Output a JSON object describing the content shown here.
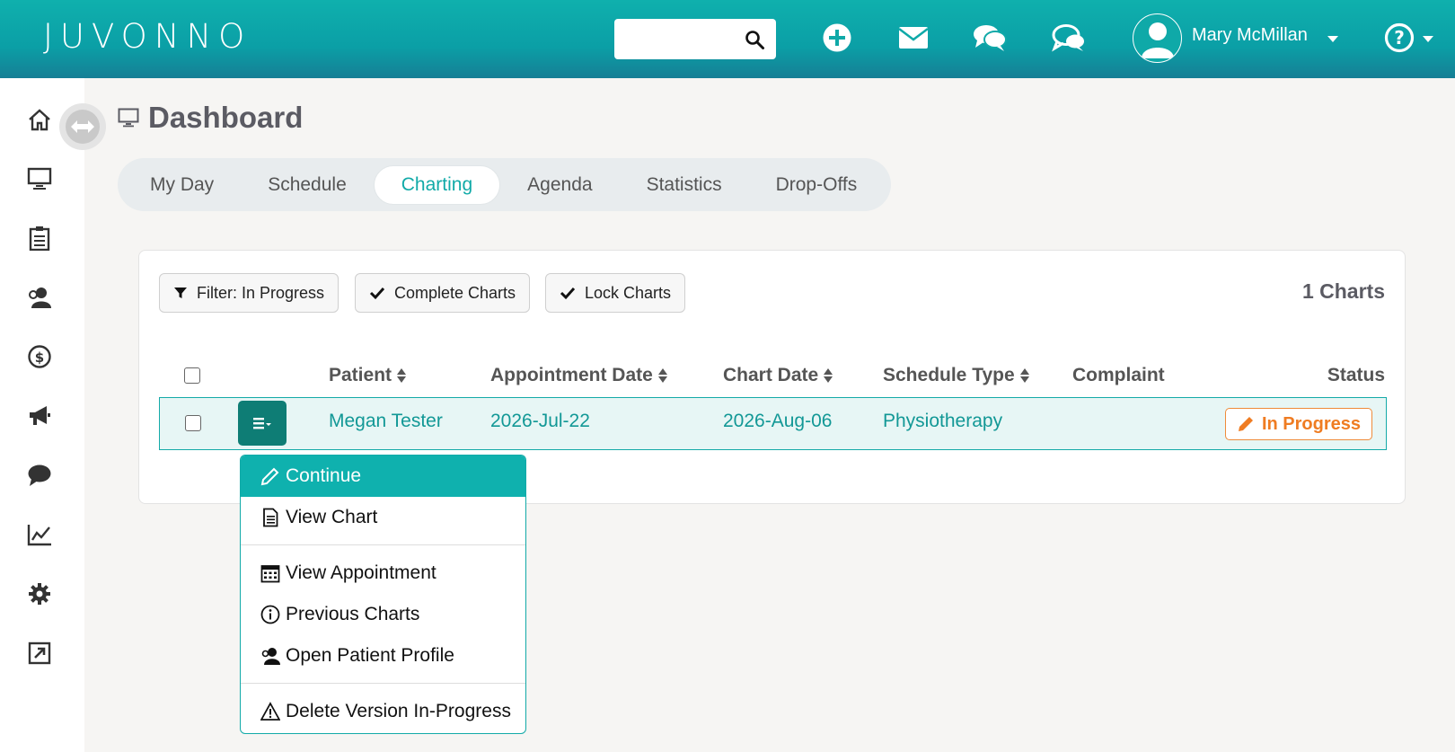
{
  "app": {
    "logo": "JUVONNO"
  },
  "header": {
    "search_placeholder": "",
    "user_name": "Mary McMillan"
  },
  "page": {
    "title": "Dashboard"
  },
  "tabs": [
    {
      "label": "My Day"
    },
    {
      "label": "Schedule"
    },
    {
      "label": "Charting",
      "active": true
    },
    {
      "label": "Agenda"
    },
    {
      "label": "Statistics"
    },
    {
      "label": "Drop-Offs"
    }
  ],
  "toolbar": {
    "filter_label": "Filter: In Progress",
    "complete_label": "Complete Charts",
    "lock_label": "Lock Charts",
    "count_label": "1 Charts"
  },
  "table": {
    "headers": {
      "patient": "Patient",
      "appointment_date": "Appointment Date",
      "chart_date": "Chart Date",
      "schedule_type": "Schedule Type",
      "complaint": "Complaint",
      "status": "Status"
    },
    "rows": [
      {
        "patient": "Megan Tester",
        "appointment_date": "2026-Jul-22",
        "chart_date": "2026-Aug-06",
        "schedule_type": "Physiotherapy",
        "complaint": "",
        "status": "In Progress"
      }
    ]
  },
  "dropdown": {
    "items": [
      {
        "label": "Continue",
        "icon": "pencil-icon",
        "active": true
      },
      {
        "label": "View Chart",
        "icon": "document-icon"
      },
      {
        "label": "View Appointment",
        "icon": "calendar-icon"
      },
      {
        "label": "Previous Charts",
        "icon": "info-icon"
      },
      {
        "label": "Open Patient Profile",
        "icon": "patient-icon"
      },
      {
        "label": "Delete Version In-Progress",
        "icon": "warning-icon"
      }
    ]
  },
  "colors": {
    "brand_teal": "#0fb0ad",
    "row_highlight": "#e7f6f5",
    "status_orange": "#ef7c22",
    "menu_button": "#0e7d75"
  }
}
